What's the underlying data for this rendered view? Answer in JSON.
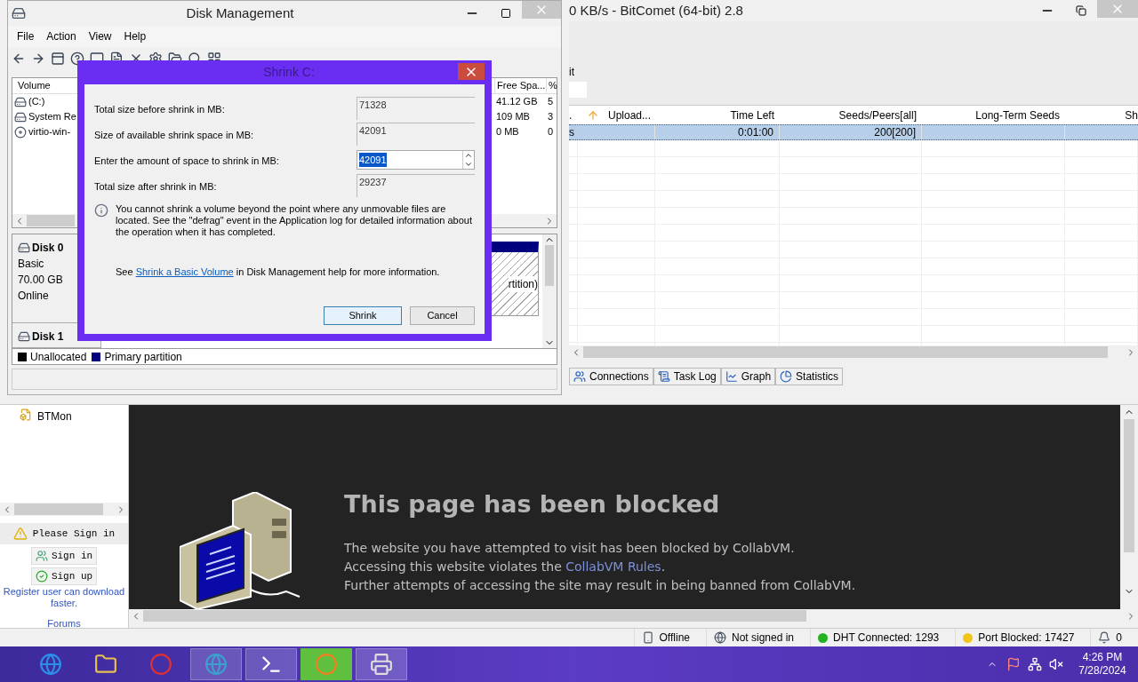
{
  "disk_management": {
    "title": "Disk Management",
    "menu": [
      "File",
      "Action",
      "View",
      "Help"
    ],
    "volume_columns": {
      "volume": "Volume",
      "free_space": "Free Spa...",
      "percent": "%"
    },
    "volumes": [
      {
        "name": "(C:)",
        "free_space": "41.12 GB",
        "percent": "5",
        "kind": "drive"
      },
      {
        "name": "System Re",
        "free_space": "109 MB",
        "percent": "3",
        "kind": "drive"
      },
      {
        "name": "virtio-win-",
        "free_space": "0 MB",
        "percent": "0",
        "kind": "disc"
      }
    ],
    "disks": [
      {
        "name": "Disk 0",
        "lines": [
          "Basic",
          "70.00 GB",
          "Online"
        ]
      },
      {
        "name": "Disk 1"
      }
    ],
    "partition_label": "rtition)",
    "legend": [
      {
        "label": "Unallocated",
        "color": "#000000"
      },
      {
        "label": "Primary partition",
        "color": "#000080"
      }
    ]
  },
  "shrink_dialog": {
    "title": "Shrink C:",
    "fields": [
      {
        "label": "Total size before shrink in MB:",
        "value": "71328",
        "kind": "readonly"
      },
      {
        "label": "Size of available shrink space in MB:",
        "value": "42091",
        "kind": "readonly"
      },
      {
        "label": "Enter the amount of space to shrink in MB:",
        "value": "42091",
        "kind": "spin"
      },
      {
        "label": "Total size after shrink in MB:",
        "value": "29237",
        "kind": "readonly"
      }
    ],
    "info": "You cannot shrink a volume beyond the point where any unmovable files are located. See the \"defrag\" event in the Application log for detailed information about the operation when it has completed.",
    "help": {
      "before": "See",
      "link": "Shrink a Basic Volume",
      "after": "in Disk Management help for more information."
    },
    "buttons": [
      {
        "label": "Shrink",
        "kind": "default"
      },
      {
        "label": "Cancel",
        "kind": "normal"
      }
    ]
  },
  "bitcomet": {
    "title": "0 KB/s - BitComet (64-bit) 2.8",
    "toolbar_text": "it",
    "columns": [
      ".",
      "Upload...",
      "Time Left",
      "Seeds/Peers[all]",
      "Long-Term Seeds",
      "Sh"
    ],
    "rows": [
      {
        "selected": true,
        "first": "s",
        "time_left": "0:01:00",
        "seeds_peers": "200[200]"
      }
    ],
    "tabs": [
      {
        "label": "Connections",
        "selected": false,
        "kind": "connections"
      },
      {
        "label": "Task Log",
        "selected": false,
        "kind": "log"
      },
      {
        "label": "Graph",
        "selected": false,
        "kind": "graph"
      },
      {
        "label": "Statistics",
        "selected": false,
        "kind": "stats"
      }
    ],
    "sidebar": {
      "tree_item": "BTMon",
      "notice": "Please Sign in",
      "sign_in": "Sign in",
      "sign_up": "Sign up",
      "register": "Register user can download faster.",
      "forums": "Forums"
    },
    "browser": {
      "heading": "This page has been blocked",
      "lines": [
        {
          "before": "The website you have attempted to visit has been blocked by CollabVM."
        },
        {
          "before": "Accessing this website violates the",
          "link": "CollabVM Rules",
          "after": "."
        },
        {
          "before": "Further attempts of accessing the site may result in being banned from CollabVM."
        }
      ]
    }
  },
  "status_bar": [
    {
      "kind": "device",
      "text": "Offline"
    },
    {
      "kind": "globe",
      "text": "Not signed in"
    },
    {
      "kind": "dot",
      "color": "#22b322",
      "text": "DHT Connected: 1293"
    },
    {
      "kind": "dot",
      "color": "#f0c419",
      "text": "Port Blocked: 17427"
    },
    {
      "kind": "bell",
      "text": "0"
    }
  ],
  "taskbar": {
    "time": "4:26 PM",
    "date": "7/28/2024"
  }
}
